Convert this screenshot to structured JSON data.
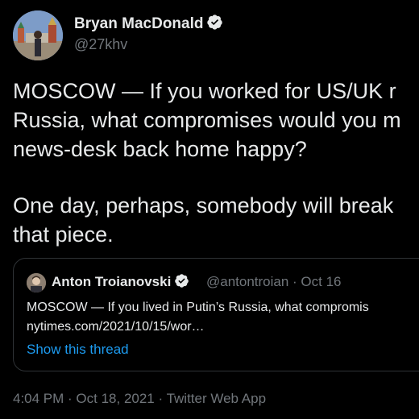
{
  "tweet": {
    "author": {
      "display_name": "Bryan MacDonald",
      "handle": "@27khv",
      "verified": true
    },
    "text_lines": [
      "MOSCOW — If you worked for US/UK r",
      "Russia, what compromises would you m",
      "news-desk back home happy?",
      "One day, perhaps, somebody will break",
      "that piece."
    ],
    "quoted": {
      "display_name": "Anton Troianovski",
      "handle_date": "@antontroian · Oct 16",
      "verified": true,
      "text_lines": [
        "MOSCOW — If you lived in Putin’s Russia, what compromis",
        "nytimes.com/2021/10/15/wor…"
      ],
      "show_thread_label": "Show this thread"
    },
    "meta": {
      "time": "4:04 PM",
      "sep1": " · ",
      "date": "Oct 18, 2021",
      "sep2": " · ",
      "source": "Twitter Web App"
    }
  },
  "colors": {
    "background": "#000000",
    "text": "#e7e9ea",
    "muted": "#71767b",
    "link": "#1d9bf0",
    "border": "#2f3336"
  },
  "icons": {
    "verified": "verified-badge-icon",
    "avatar": "profile-photo",
    "quote_avatar": "profile-photo"
  }
}
